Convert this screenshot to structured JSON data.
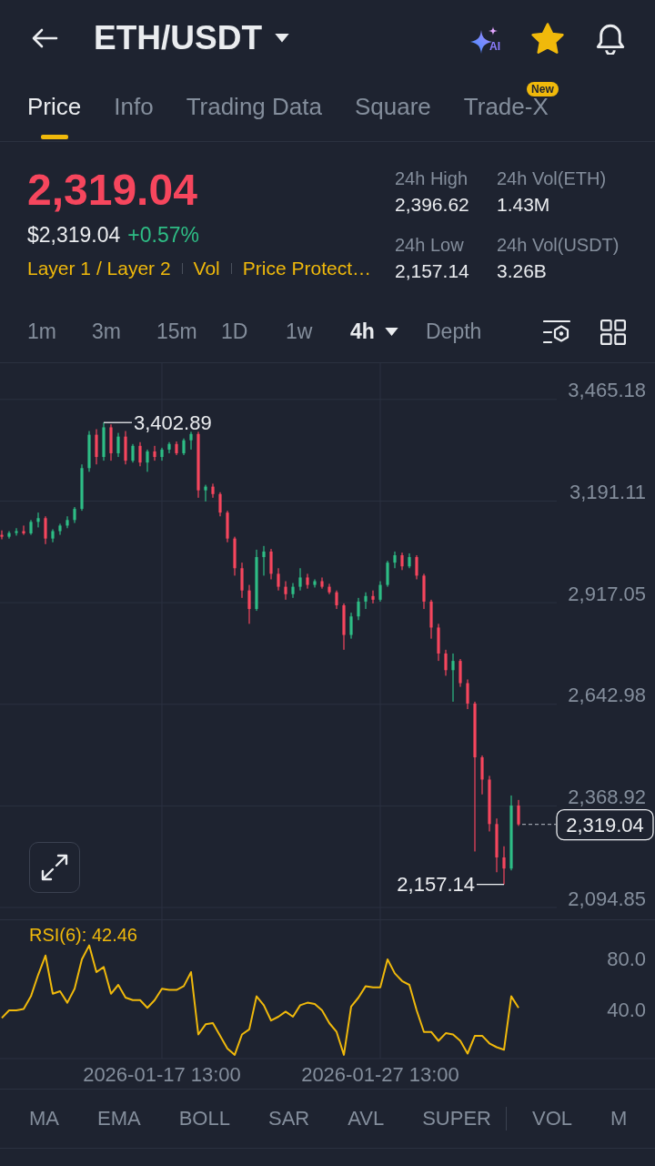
{
  "header": {
    "title": "ETH/USDT",
    "ai_label": "AI",
    "favorited": true
  },
  "tabs": [
    {
      "label": "Price",
      "selected": true
    },
    {
      "label": "Info",
      "selected": false
    },
    {
      "label": "Trading Data",
      "selected": false
    },
    {
      "label": "Square",
      "selected": false
    },
    {
      "label": "Trade-X",
      "selected": false,
      "badge": "New"
    }
  ],
  "ticker": {
    "price": "2,319.04",
    "price_up": false,
    "fiat_price": "$2,319.04",
    "change": "+0.57%",
    "change_up": true,
    "tags": [
      "Layer 1 / Layer 2",
      "Vol",
      "Price Protect…"
    ],
    "stats": [
      {
        "label": "24h High",
        "value": "2,396.62"
      },
      {
        "label": "24h Vol(ETH)",
        "value": "1.43M"
      },
      {
        "label": "24h Low",
        "value": "2,157.14"
      },
      {
        "label": "24h Vol(USDT)",
        "value": "3.26B"
      }
    ]
  },
  "intervals": [
    {
      "label": "1m",
      "selected": false,
      "dropdown": false
    },
    {
      "label": "3m",
      "selected": false,
      "dropdown": false
    },
    {
      "label": "15m",
      "selected": false,
      "dropdown": false
    },
    {
      "label": "1D",
      "selected": false,
      "dropdown": false
    },
    {
      "label": "1w",
      "selected": false,
      "dropdown": false
    },
    {
      "label": "4h",
      "selected": true,
      "dropdown": true
    },
    {
      "label": "Depth",
      "selected": false,
      "dropdown": false
    }
  ],
  "price_chart": {
    "chart_data": {
      "type": "candlestick",
      "grid": true,
      "categories": [
        null,
        null,
        null,
        null,
        null,
        null,
        null,
        null,
        null,
        null,
        null,
        null,
        null,
        null,
        null,
        null,
        null,
        null,
        null,
        null,
        null,
        null,
        null,
        null,
        null,
        null,
        null,
        null,
        null,
        null,
        null,
        null,
        null,
        null,
        null,
        null,
        null,
        null,
        null,
        null,
        null,
        null,
        null,
        null,
        null,
        null,
        null,
        null,
        null,
        null,
        null,
        null,
        null,
        null,
        null,
        null,
        null,
        null,
        null,
        null,
        null,
        null,
        null,
        null,
        null,
        null,
        null,
        null,
        null,
        null,
        null,
        null
      ],
      "ohlc": [
        [
          3100,
          3112,
          3088,
          3095
        ],
        [
          3095,
          3110,
          3090,
          3105
        ],
        [
          3105,
          3118,
          3098,
          3110
        ],
        [
          3110,
          3125,
          3100,
          3104
        ],
        [
          3104,
          3140,
          3100,
          3135
        ],
        [
          3135,
          3160,
          3120,
          3145
        ],
        [
          3145,
          3150,
          3075,
          3090
        ],
        [
          3090,
          3115,
          3080,
          3110
        ],
        [
          3110,
          3130,
          3100,
          3125
        ],
        [
          3125,
          3150,
          3118,
          3140
        ],
        [
          3140,
          3175,
          3132,
          3170
        ],
        [
          3170,
          3290,
          3165,
          3280
        ],
        [
          3280,
          3380,
          3270,
          3370
        ],
        [
          3370,
          3385,
          3290,
          3310
        ],
        [
          3310,
          3402.89,
          3300,
          3390
        ],
        [
          3390,
          3398,
          3300,
          3320
        ],
        [
          3320,
          3375,
          3310,
          3365
        ],
        [
          3365,
          3380,
          3290,
          3300
        ],
        [
          3300,
          3345,
          3295,
          3340
        ],
        [
          3340,
          3350,
          3285,
          3295
        ],
        [
          3295,
          3330,
          3270,
          3325
        ],
        [
          3325,
          3340,
          3300,
          3310
        ],
        [
          3310,
          3335,
          3300,
          3330
        ],
        [
          3330,
          3350,
          3320,
          3345
        ],
        [
          3345,
          3352,
          3315,
          3320
        ],
        [
          3320,
          3360,
          3315,
          3355
        ],
        [
          3355,
          3378,
          3330,
          3372
        ],
        [
          3372,
          3378,
          3200,
          3220
        ],
        [
          3220,
          3235,
          3190,
          3230
        ],
        [
          3230,
          3238,
          3200,
          3210
        ],
        [
          3210,
          3215,
          3150,
          3160
        ],
        [
          3160,
          3165,
          3080,
          3090
        ],
        [
          3090,
          3095,
          2990,
          3010
        ],
        [
          3010,
          3025,
          2930,
          2950
        ],
        [
          2950,
          2965,
          2860,
          2900
        ],
        [
          2900,
          3060,
          2895,
          3040
        ],
        [
          3040,
          3070,
          2990,
          3055
        ],
        [
          3055,
          3062,
          2980,
          2995
        ],
        [
          2995,
          3010,
          2950,
          2960
        ],
        [
          2960,
          2975,
          2925,
          2940
        ],
        [
          2940,
          2970,
          2930,
          2960
        ],
        [
          2960,
          3010,
          2950,
          2985
        ],
        [
          2985,
          2995,
          2955,
          2965
        ],
        [
          2965,
          2980,
          2958,
          2975
        ],
        [
          2975,
          2985,
          2955,
          2960
        ],
        [
          2960,
          2968,
          2940,
          2945
        ],
        [
          2945,
          2950,
          2900,
          2910
        ],
        [
          2910,
          2915,
          2790,
          2830
        ],
        [
          2830,
          2890,
          2820,
          2880
        ],
        [
          2880,
          2930,
          2870,
          2920
        ],
        [
          2920,
          2945,
          2900,
          2935
        ],
        [
          2935,
          2950,
          2915,
          2925
        ],
        [
          2925,
          2975,
          2920,
          2965
        ],
        [
          2965,
          3030,
          2960,
          3025
        ],
        [
          3025,
          3055,
          3010,
          3045
        ],
        [
          3045,
          3052,
          3005,
          3015
        ],
        [
          3015,
          3050,
          3010,
          3040
        ],
        [
          3040,
          3045,
          2980,
          2990
        ],
        [
          2990,
          2995,
          2900,
          2920
        ],
        [
          2920,
          2925,
          2820,
          2850
        ],
        [
          2850,
          2860,
          2760,
          2780
        ],
        [
          2780,
          2790,
          2720,
          2735
        ],
        [
          2735,
          2780,
          2650,
          2760
        ],
        [
          2760,
          2765,
          2690,
          2700
        ],
        [
          2700,
          2710,
          2630,
          2645
        ],
        [
          2645,
          2650,
          2246,
          2500
        ],
        [
          2500,
          2505,
          2400,
          2440
        ],
        [
          2440,
          2450,
          2300,
          2320
        ],
        [
          2320,
          2335,
          2190,
          2230
        ],
        [
          2230,
          2260,
          2157.14,
          2200
        ],
        [
          2200,
          2397,
          2195,
          2370
        ],
        [
          2370,
          2385,
          2315,
          2319.04
        ]
      ],
      "ylim": [
        2063,
        3563
      ],
      "yticks": [
        {
          "value": 3465.18,
          "label": "3,465.18"
        },
        {
          "value": 3191.11,
          "label": "3,191.11"
        },
        {
          "value": 2917.05,
          "label": "2,917.05"
        },
        {
          "value": 2642.98,
          "label": "2,642.98"
        },
        {
          "value": 2368.92,
          "label": "2,368.92"
        },
        {
          "value": 2094.85,
          "label": "2,094.85"
        }
      ]
    },
    "high_label": "3,402.89",
    "low_label": "2,157.14",
    "last_price": "2,319.04"
  },
  "rsi": {
    "chart_data": {
      "type": "line",
      "grid": true,
      "title": "RSI(6): 42.46",
      "categories": [
        null,
        null,
        null,
        null,
        null,
        null,
        null,
        null,
        null,
        null,
        null,
        null,
        null,
        null,
        null,
        null,
        null,
        null,
        null,
        null,
        null,
        null,
        "2026-01-17 13:00",
        null,
        null,
        null,
        null,
        null,
        null,
        null,
        null,
        null,
        null,
        null,
        null,
        null,
        null,
        null,
        null,
        null,
        null,
        null,
        null,
        null,
        null,
        null,
        null,
        null,
        null,
        null,
        null,
        null,
        "2026-01-27 13:00",
        null,
        null,
        null,
        null,
        null,
        null,
        null,
        null,
        null,
        null,
        null,
        null,
        null,
        null,
        null,
        null,
        null,
        null,
        null
      ],
      "series": [
        {
          "color": "#f0b90b",
          "values": [
            34,
            40,
            40,
            41,
            51,
            68,
            83,
            53,
            55,
            46,
            57,
            80,
            91,
            70,
            74,
            53,
            60,
            50,
            48,
            48,
            42,
            48,
            57,
            56,
            56,
            59,
            70,
            21,
            29,
            30,
            20,
            10,
            5,
            21,
            25,
            51,
            44,
            32,
            35,
            39,
            35,
            44,
            46,
            45,
            40,
            30,
            23,
            5,
            43,
            50,
            59,
            58,
            58,
            80,
            69,
            63,
            60,
            40,
            23,
            23,
            16,
            22,
            21,
            16,
            6,
            20,
            20,
            14,
            11,
            9,
            51,
            42
          ]
        }
      ],
      "ylim": [
        2.1,
        110.7
      ],
      "yticks": [
        {
          "value": 80,
          "label": "80.0"
        },
        {
          "value": 40,
          "label": "40.0"
        }
      ]
    }
  },
  "indicator_groups": [
    [
      "MA",
      "EMA",
      "BOLL",
      "SAR",
      "AVL",
      "SUPER"
    ],
    [
      "VOL",
      "M"
    ]
  ]
}
